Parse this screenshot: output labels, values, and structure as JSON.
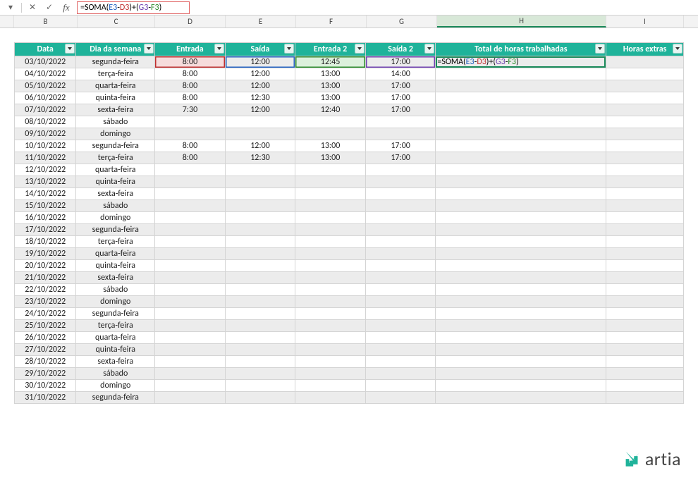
{
  "formula_bar": {
    "formula_segments": [
      {
        "t": "=SOMA(",
        "c": "black"
      },
      {
        "t": "E3",
        "c": "blue"
      },
      {
        "t": "-",
        "c": "black"
      },
      {
        "t": "D3",
        "c": "red"
      },
      {
        "t": ")+(",
        "c": "black"
      },
      {
        "t": "G3",
        "c": "purple"
      },
      {
        "t": "-",
        "c": "black"
      },
      {
        "t": "F3",
        "c": "green"
      },
      {
        "t": ")",
        "c": "black"
      }
    ]
  },
  "column_letters": [
    "",
    "B",
    "C",
    "D",
    "E",
    "F",
    "G",
    "H",
    "I"
  ],
  "selected_column": "H",
  "table": {
    "headers": [
      "Data",
      "Dia da semana",
      "Entrada",
      "Saída",
      "Entrada 2",
      "Saída 2",
      "Total de horas trabalhadas",
      "Horas extras"
    ],
    "rows": [
      {
        "data": "03/10/2022",
        "dia": "segunda-feira",
        "e1": "8:00",
        "s1": "12:00",
        "e2": "12:45",
        "s2": "17:00",
        "total": "formula",
        "extras": ""
      },
      {
        "data": "04/10/2022",
        "dia": "terça-feira",
        "e1": "8:00",
        "s1": "12:00",
        "e2": "13:00",
        "s2": "14:00",
        "total": "",
        "extras": ""
      },
      {
        "data": "05/10/2022",
        "dia": "quarta-feira",
        "e1": "8:00",
        "s1": "12:00",
        "e2": "13:00",
        "s2": "17:00",
        "total": "",
        "extras": ""
      },
      {
        "data": "06/10/2022",
        "dia": "quinta-feira",
        "e1": "8:00",
        "s1": "12:30",
        "e2": "13:00",
        "s2": "17:00",
        "total": "",
        "extras": ""
      },
      {
        "data": "07/10/2022",
        "dia": "sexta-feira",
        "e1": "7:30",
        "s1": "12:00",
        "e2": "12:40",
        "s2": "17:00",
        "total": "",
        "extras": ""
      },
      {
        "data": "08/10/2022",
        "dia": "sábado",
        "e1": "",
        "s1": "",
        "e2": "",
        "s2": "",
        "total": "",
        "extras": ""
      },
      {
        "data": "09/10/2022",
        "dia": "domingo",
        "e1": "",
        "s1": "",
        "e2": "",
        "s2": "",
        "total": "",
        "extras": ""
      },
      {
        "data": "10/10/2022",
        "dia": "segunda-feira",
        "e1": "8:00",
        "s1": "12:00",
        "e2": "13:00",
        "s2": "17:00",
        "total": "",
        "extras": ""
      },
      {
        "data": "11/10/2022",
        "dia": "terça-feira",
        "e1": "8:00",
        "s1": "12:30",
        "e2": "13:00",
        "s2": "17:00",
        "total": "",
        "extras": ""
      },
      {
        "data": "12/10/2022",
        "dia": "quarta-feira",
        "e1": "",
        "s1": "",
        "e2": "",
        "s2": "",
        "total": "",
        "extras": ""
      },
      {
        "data": "13/10/2022",
        "dia": "quinta-feira",
        "e1": "",
        "s1": "",
        "e2": "",
        "s2": "",
        "total": "",
        "extras": ""
      },
      {
        "data": "14/10/2022",
        "dia": "sexta-feira",
        "e1": "",
        "s1": "",
        "e2": "",
        "s2": "",
        "total": "",
        "extras": ""
      },
      {
        "data": "15/10/2022",
        "dia": "sábado",
        "e1": "",
        "s1": "",
        "e2": "",
        "s2": "",
        "total": "",
        "extras": ""
      },
      {
        "data": "16/10/2022",
        "dia": "domingo",
        "e1": "",
        "s1": "",
        "e2": "",
        "s2": "",
        "total": "",
        "extras": ""
      },
      {
        "data": "17/10/2022",
        "dia": "segunda-feira",
        "e1": "",
        "s1": "",
        "e2": "",
        "s2": "",
        "total": "",
        "extras": ""
      },
      {
        "data": "18/10/2022",
        "dia": "terça-feira",
        "e1": "",
        "s1": "",
        "e2": "",
        "s2": "",
        "total": "",
        "extras": ""
      },
      {
        "data": "19/10/2022",
        "dia": "quarta-feira",
        "e1": "",
        "s1": "",
        "e2": "",
        "s2": "",
        "total": "",
        "extras": ""
      },
      {
        "data": "20/10/2022",
        "dia": "quinta-feira",
        "e1": "",
        "s1": "",
        "e2": "",
        "s2": "",
        "total": "",
        "extras": ""
      },
      {
        "data": "21/10/2022",
        "dia": "sexta-feira",
        "e1": "",
        "s1": "",
        "e2": "",
        "s2": "",
        "total": "",
        "extras": ""
      },
      {
        "data": "22/10/2022",
        "dia": "sábado",
        "e1": "",
        "s1": "",
        "e2": "",
        "s2": "",
        "total": "",
        "extras": ""
      },
      {
        "data": "23/10/2022",
        "dia": "domingo",
        "e1": "",
        "s1": "",
        "e2": "",
        "s2": "",
        "total": "",
        "extras": ""
      },
      {
        "data": "24/10/2022",
        "dia": "segunda-feira",
        "e1": "",
        "s1": "",
        "e2": "",
        "s2": "",
        "total": "",
        "extras": ""
      },
      {
        "data": "25/10/2022",
        "dia": "terça-feira",
        "e1": "",
        "s1": "",
        "e2": "",
        "s2": "",
        "total": "",
        "extras": ""
      },
      {
        "data": "26/10/2022",
        "dia": "quarta-feira",
        "e1": "",
        "s1": "",
        "e2": "",
        "s2": "",
        "total": "",
        "extras": ""
      },
      {
        "data": "27/10/2022",
        "dia": "quinta-feira",
        "e1": "",
        "s1": "",
        "e2": "",
        "s2": "",
        "total": "",
        "extras": ""
      },
      {
        "data": "28/10/2022",
        "dia": "sexta-feira",
        "e1": "",
        "s1": "",
        "e2": "",
        "s2": "",
        "total": "",
        "extras": ""
      },
      {
        "data": "29/10/2022",
        "dia": "sábado",
        "e1": "",
        "s1": "",
        "e2": "",
        "s2": "",
        "total": "",
        "extras": ""
      },
      {
        "data": "30/10/2022",
        "dia": "domingo",
        "e1": "",
        "s1": "",
        "e2": "",
        "s2": "",
        "total": "",
        "extras": ""
      },
      {
        "data": "31/10/2022",
        "dia": "segunda-feira",
        "e1": "",
        "s1": "",
        "e2": "",
        "s2": "",
        "total": "",
        "extras": ""
      }
    ]
  },
  "logo_text": "artia",
  "colors": {
    "header_bg": "#1fb39a",
    "accent": "#1a8a5a",
    "ref_red": "#c03030",
    "ref_blue": "#2060c0",
    "ref_green": "#2a8a2a",
    "ref_purple": "#7040b0"
  }
}
